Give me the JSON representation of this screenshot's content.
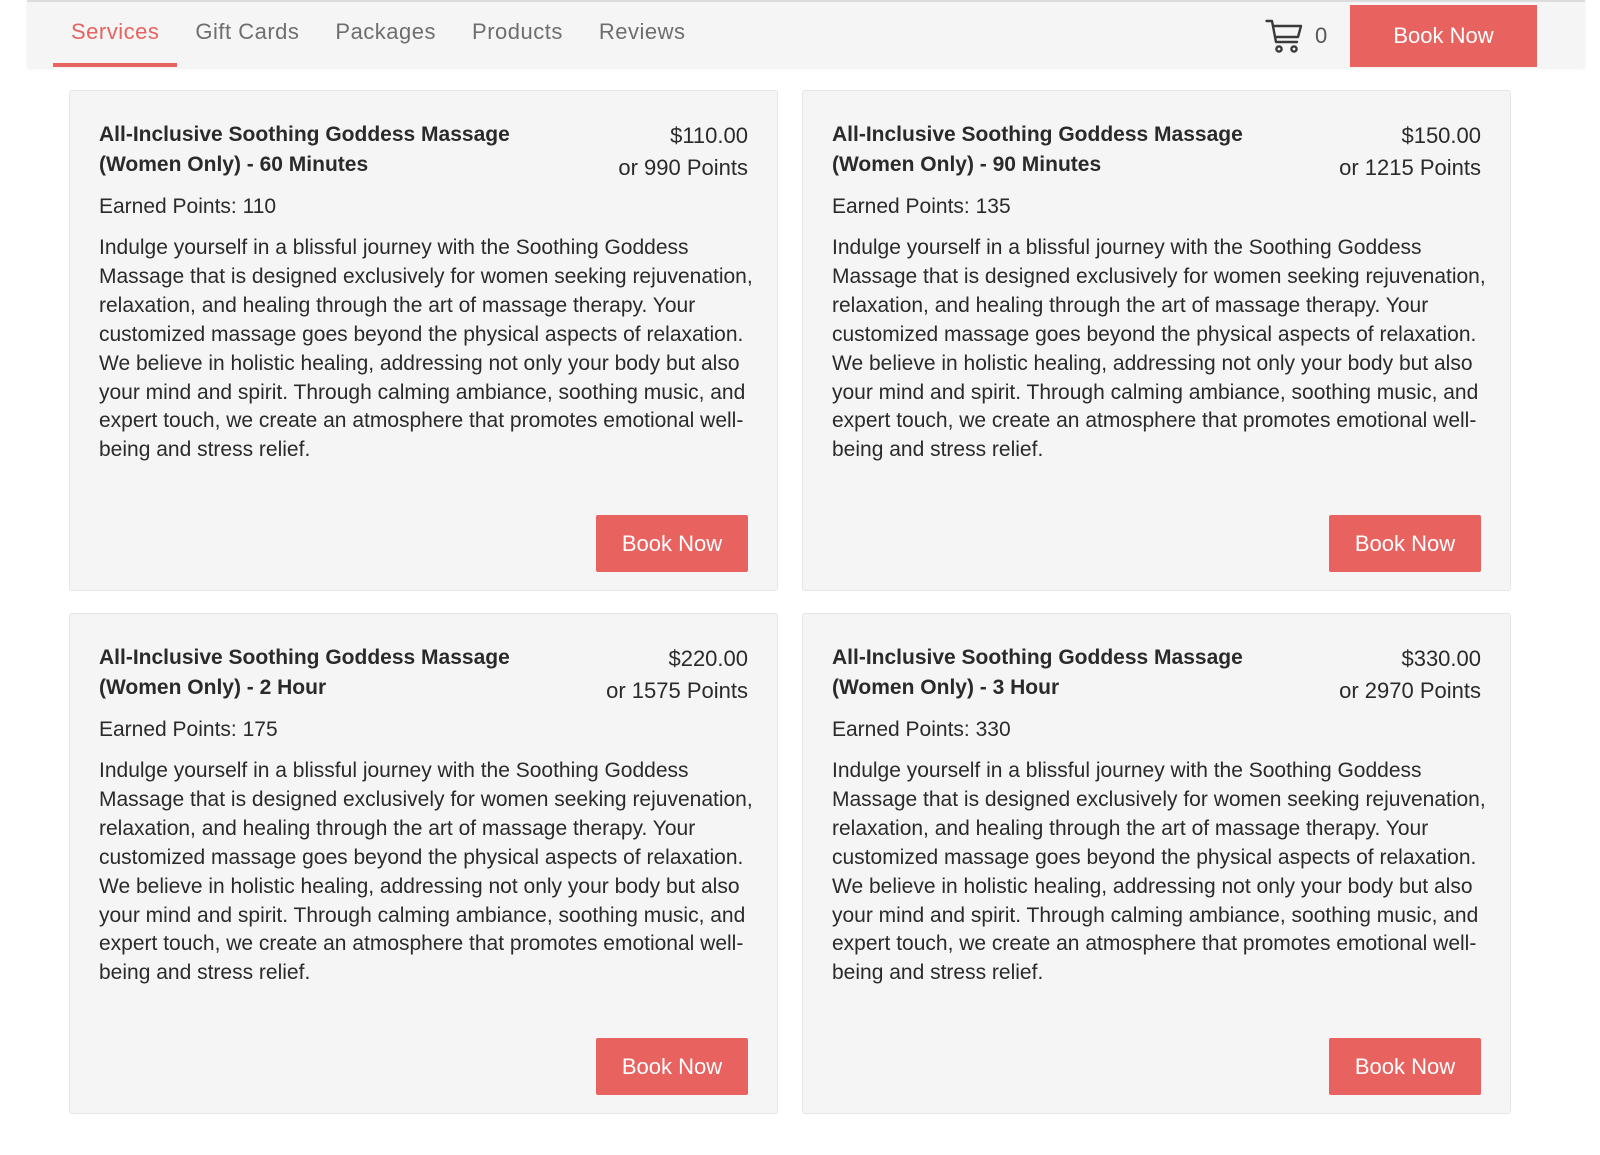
{
  "nav": {
    "tabs": [
      {
        "label": "Services",
        "active": true
      },
      {
        "label": "Gift Cards",
        "active": false
      },
      {
        "label": "Packages",
        "active": false
      },
      {
        "label": "Products",
        "active": false
      },
      {
        "label": "Reviews",
        "active": false
      }
    ],
    "cart_icon": "shopping-cart-icon",
    "cart_count": "0",
    "book_now_label": "Book Now"
  },
  "colors": {
    "accent": "#e8625f",
    "card_bg": "#f5f5f5",
    "text": "#2a2a2a"
  },
  "services": [
    {
      "title": "All-Inclusive Soothing Goddess Massage (Women Only) - 60 Minutes",
      "price": "$110.00",
      "points_price": "or 990 Points",
      "earned_label": "Earned Points: 110",
      "description": "Indulge yourself in a blissful journey with the Soothing Goddess Massage that is designed exclusively for women seeking rejuvenation, relaxation, and healing through the art of massage therapy. Your customized massage goes beyond the physical aspects of relaxation. We believe in holistic healing, addressing not only your body but also your mind and spirit. Through calming ambiance, soothing music, and expert touch, we create an atmosphere that promotes emotional well-being and stress relief.",
      "button_label": "Book Now"
    },
    {
      "title": "All-Inclusive Soothing Goddess Massage (Women Only) - 90 Minutes",
      "price": "$150.00",
      "points_price": "or 1215 Points",
      "earned_label": "Earned Points: 135",
      "description": "Indulge yourself in a blissful journey with the Soothing Goddess Massage that is designed exclusively for women seeking rejuvenation, relaxation, and healing through the art of massage therapy. Your customized massage goes beyond the physical aspects of relaxation. We believe in holistic healing, addressing not only your body but also your mind and spirit. Through calming ambiance, soothing music, and expert touch, we create an atmosphere that promotes emotional well-being and stress relief.",
      "button_label": "Book Now"
    },
    {
      "title": "All-Inclusive Soothing Goddess Massage (Women Only) - 2 Hour",
      "price": "$220.00",
      "points_price": "or 1575 Points",
      "earned_label": "Earned Points: 175",
      "description": "Indulge yourself in a blissful journey with the Soothing Goddess Massage that is designed exclusively for women seeking rejuvenation, relaxation, and healing through the art of massage therapy. Your customized massage goes beyond the physical aspects of relaxation. We believe in holistic healing, addressing not only your body but also your mind and spirit. Through calming ambiance, soothing music, and expert touch, we create an atmosphere that promotes emotional well-being and stress relief.",
      "button_label": "Book Now"
    },
    {
      "title": "All-Inclusive Soothing Goddess Massage (Women Only) - 3 Hour",
      "price": "$330.00",
      "points_price": "or 2970 Points",
      "earned_label": "Earned Points: 330",
      "description": "Indulge yourself in a blissful journey with the Soothing Goddess Massage that is designed exclusively for women seeking rejuvenation, relaxation, and healing through the art of massage therapy. Your customized massage goes beyond the physical aspects of relaxation. We believe in holistic healing, addressing not only your body but also your mind and spirit. Through calming ambiance, soothing music, and expert touch, we create an atmosphere that promotes emotional well-being and stress relief.",
      "button_label": "Book Now"
    }
  ]
}
